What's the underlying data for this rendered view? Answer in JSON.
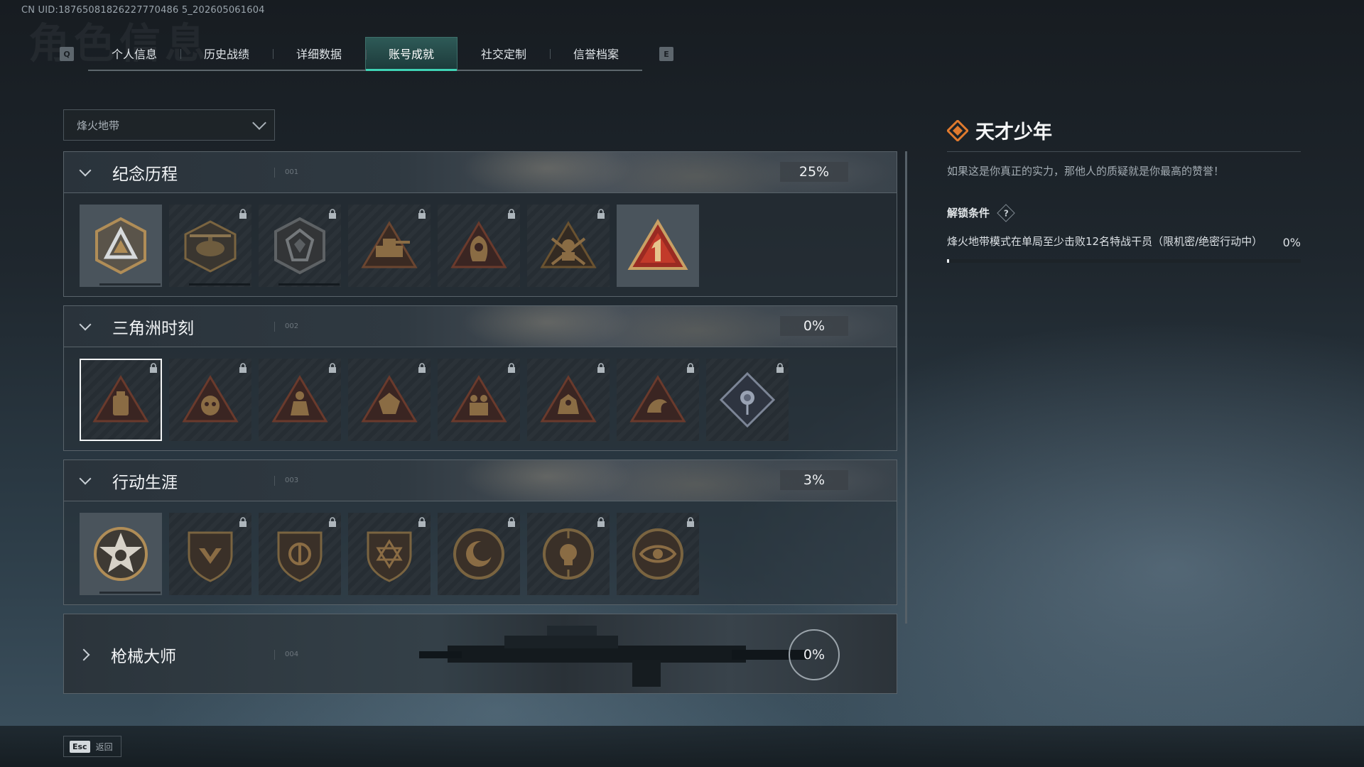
{
  "uid": "CN UID:18765081826227770486 5_202605061604",
  "bg_title": "角色信息",
  "tabs": {
    "left_key": "Q",
    "right_key": "E",
    "items": [
      "个人信息",
      "历史战绩",
      "详细数据",
      "账号成就",
      "社交定制",
      "信誉档案"
    ],
    "active_index": 3
  },
  "mode_select": {
    "value": "烽火地带"
  },
  "categories": [
    {
      "title": "纪念历程",
      "num": "001",
      "percent": "25%",
      "expanded": true,
      "badges": [
        "triangle-shield-badge-icon",
        "helicopter-badge-icon",
        "emblem-shield-badge-icon",
        "tank-badge-icon",
        "hooded-figure-badge-icon",
        "soldier-crossed-rifles-badge-icon",
        "number-one-badge-icon"
      ]
    },
    {
      "title": "三角洲时刻",
      "num": "002",
      "percent": "0%",
      "expanded": true,
      "badges": [
        "backpack-badge-icon",
        "gasmask-badge-icon",
        "kneeling-soldier-badge-icon",
        "fist-badge-icon",
        "soldiers-badge-icon",
        "beast-badge-icon",
        "dragon-badge-icon",
        "rose-badge-icon"
      ]
    },
    {
      "title": "行动生涯",
      "num": "003",
      "percent": "3%",
      "expanded": true,
      "badges": [
        "skull-star-badge-icon",
        "wing-shield-badge-icon",
        "split-shield-badge-icon",
        "star-shield-badge-icon",
        "moon-coin-badge-icon",
        "skull-coin-badge-icon",
        "eye-coin-badge-icon"
      ]
    },
    {
      "title": "枪械大师",
      "num": "004",
      "percent": "0%",
      "expanded": false,
      "badges": []
    }
  ],
  "detail": {
    "title": "天才少年",
    "description": "如果这是你真正的实力，那他人的质疑就是你最高的赞誉！",
    "condition_label": "解锁条件",
    "help": "?",
    "condition_text": "烽火地带模式在单局至少击败12名特战干员（限机密/绝密行动中）",
    "condition_percent": "0%",
    "condition_progress": 0.0
  },
  "bottom": {
    "esc_key": "Esc",
    "back_label": "返回"
  },
  "colors": {
    "accent": "#3fd3b5",
    "title_icon": "#e07a2e",
    "badge_gold": "#b08d57",
    "badge_red": "#9a2a22"
  }
}
